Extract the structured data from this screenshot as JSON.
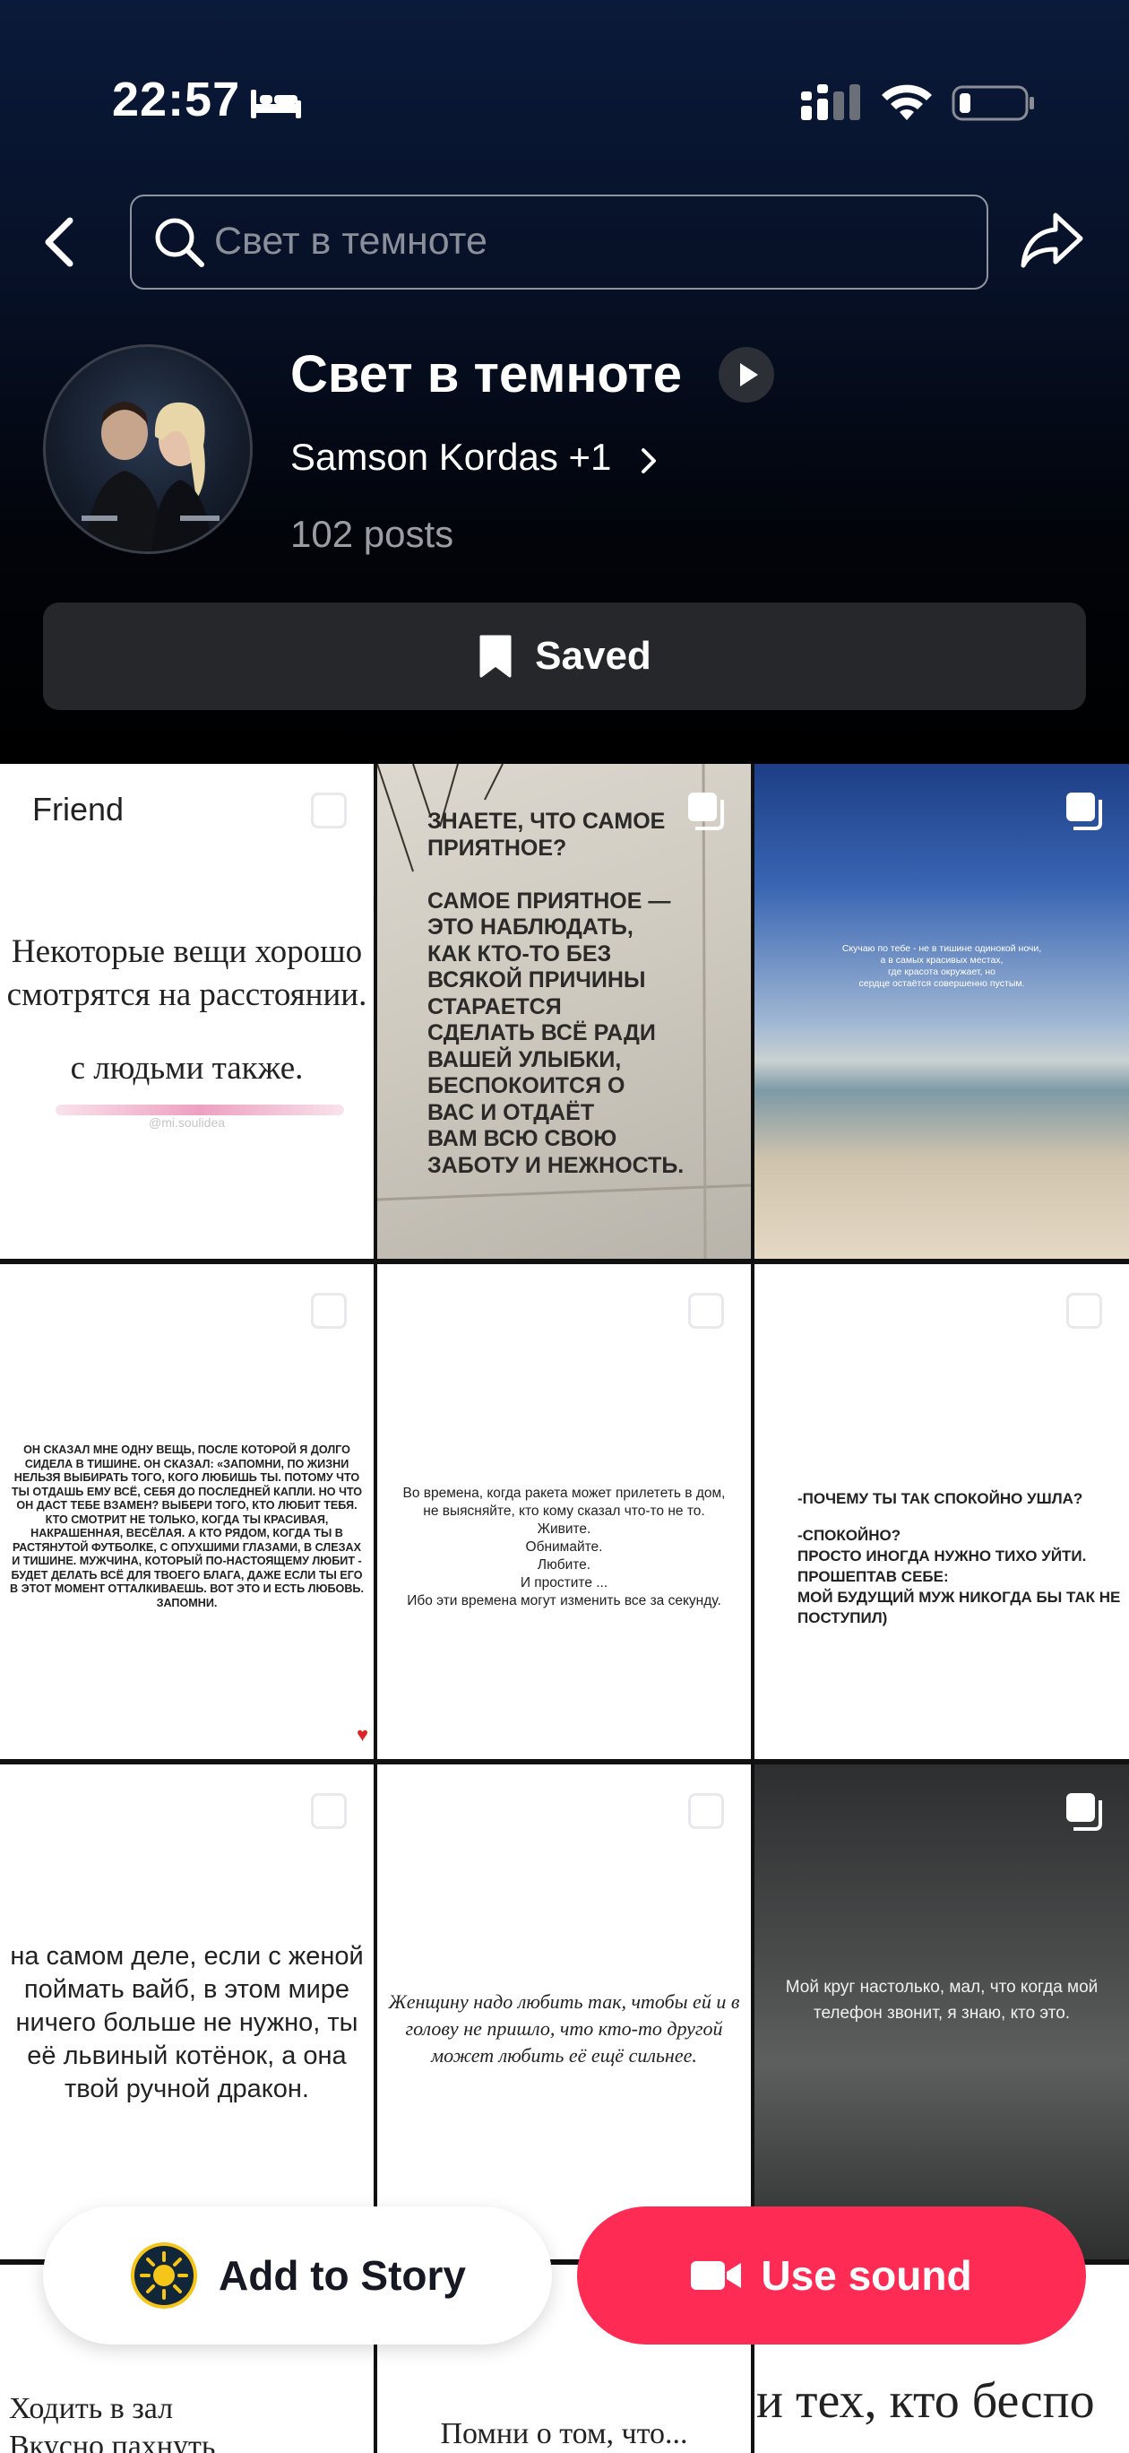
{
  "status_bar": {
    "time": "22:57"
  },
  "search": {
    "placeholder": "Свет в темноте"
  },
  "sound": {
    "title": "Свет в темноте",
    "artist": "Samson Kordas +1",
    "posts": "102 posts",
    "saved_label": "Saved"
  },
  "grid": {
    "t1": {
      "tag": "Friend",
      "line1": "Некоторые вещи хорошо",
      "line2": "смотрятся на расстоянии.",
      "line3": "с людьми также.",
      "watermark": "@mi.soulidea"
    },
    "t2": {
      "lines": [
        "ЗНАЕТЕ, ЧТО САМОЕ",
        "ПРИЯТНОЕ?",
        "",
        "САМОЕ ПРИЯТНОЕ —",
        "ЭТО НАБЛЮДАТЬ,",
        "КАК КТО-ТО БЕЗ",
        "ВСЯКОЙ ПРИЧИНЫ",
        "СТАРАЕТСЯ",
        "СДЕЛАТЬ ВСЁ РАДИ",
        "ВАШЕЙ УЛЫБКИ,",
        "БЕСПОКОИТСЯ О",
        "ВАС И ОТДАЁТ",
        "ВАМ ВСЮ СВОЮ",
        "ЗАБОТУ И НЕЖНОСТЬ."
      ]
    },
    "t3": {
      "lines": [
        "Скучаю по тебе - не в тишине одинокой ночи,",
        "а в самых красивых местах,",
        "где красота окружает, но",
        "сердце остаётся совершенно пустым."
      ]
    },
    "t4": {
      "lines": [
        "ОН СКАЗАЛ МНЕ ОДНУ ВЕЩЬ, ПОСЛЕ КОТОРОЙ Я ДОЛГО",
        "СИДЕЛА В ТИШИНЕ. ОН СКАЗАЛ: «ЗАПОМНИ, ПО ЖИЗНИ",
        "НЕЛЬЗЯ ВЫБИРАТЬ ТОГО, КОГО ЛЮБИШЬ ТЫ. ПОТОМУ ЧТО",
        "ТЫ ОТДАШЬ ЕМУ ВСЁ, СЕБЯ ДО ПОСЛЕДНЕЙ КАПЛИ. НО ЧТО",
        "ОН ДАСТ ТЕБЕ ВЗАМЕН? ВЫБЕРИ ТОГО, КТО ЛЮБИТ ТЕБЯ.",
        "КТО СМОТРИТ НЕ ТОЛЬКО, КОГДА ТЫ КРАСИВАЯ,",
        "НАКРАШЕННАЯ, ВЕСЁЛАЯ. А КТО РЯДОМ, КОГДА ТЫ В",
        "РАСТЯНУТОЙ ФУТБОЛКЕ, С ОПУХШИМИ ГЛАЗАМИ, В СЛЕЗАХ",
        "И ТИШИНЕ. МУЖЧИНА, КОТОРЫЙ ПО-НАСТОЯЩЕМУ ЛЮБИТ -",
        "БУДЕТ ДЕЛАТЬ ВСЁ ДЛЯ ТВОЕГО БЛАГА, ДАЖЕ ЕСЛИ ТЫ ЕГО",
        "В ЭТОТ МОМЕНТ ОТТАЛКИВАЕШЬ. ВОТ ЭТО И ЕСТЬ ЛЮБОВЬ.",
        "ЗАПОМНИ."
      ]
    },
    "t5": {
      "lines": [
        "Во времена, когда ракета может прилететь в дом,",
        "не выясняйте, кто кому сказал что-то не то.",
        "Живите.",
        "Обнимайте.",
        "Любите.",
        "И простите ...",
        "Ибо эти времена могут изменить все за секунду."
      ]
    },
    "t6": {
      "lines": [
        "-ПОЧЕМУ ТЫ ТАК СПОКОЙНО УШЛА?",
        "",
        "-СПОКОЙНО?",
        "ПРОСТО ИНОГДА НУЖНО ТИХО УЙТИ.",
        "ПРОШЕПТАВ СЕБЕ:",
        "МОЙ БУДУЩИЙ МУЖ НИКОГДА БЫ ТАК НЕ",
        "ПОСТУПИЛ)"
      ]
    },
    "t7": {
      "lines": [
        "на самом деле, если с женой",
        "поймать вайб, в этом мире",
        "ничего больше не нужно, ты",
        "её львиный котёнок, а она",
        "твой ручной дракон."
      ]
    },
    "t8": {
      "lines": [
        "Женщину надо любить так, чтобы ей и в",
        "голову не пришло, что кто-то другой",
        "может любить её ещё сильнее."
      ]
    },
    "t9": {
      "lines": [
        "Мой круг настолько, мал, что когда мой",
        "телефон звонит, я знаю, кто это."
      ]
    },
    "t10": {
      "lines": [
        "Ходить в зал",
        "Вкусно пахнуть"
      ]
    },
    "t11": {
      "lines": [
        "Помни о том, что..."
      ]
    },
    "t12": {
      "lines": [
        "и тех, кто беспо"
      ]
    }
  },
  "actions": {
    "add_to_story": "Add to Story",
    "use_sound": "Use sound"
  },
  "colors": {
    "accent": "#fe2c55",
    "header_top": "#0a1a3a",
    "saved_button_bg": "#26272b"
  }
}
